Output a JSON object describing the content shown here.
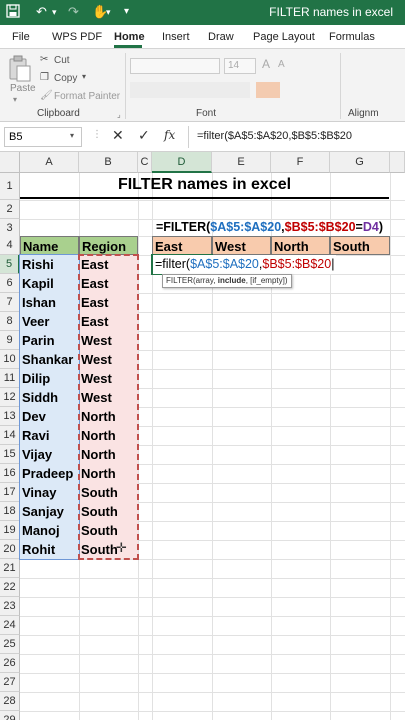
{
  "window": {
    "title": "FILTER names in excel"
  },
  "ribbon_tabs": [
    "File",
    "WPS PDF",
    "Home",
    "Insert",
    "Draw",
    "Page Layout",
    "Formulas"
  ],
  "active_tab": "Home",
  "clipboard": {
    "paste": "Paste",
    "cut": "Cut",
    "copy": "Copy",
    "format_painter": "Format Painter",
    "label": "Clipboard"
  },
  "font_group": {
    "size": "14",
    "label": "Font"
  },
  "alignment_label": "Alignm",
  "formula_bar": {
    "name_box": "B5",
    "formula": "=filter($A$5:$A$20,$B$5:$B$20"
  },
  "columns": [
    "A",
    "B",
    "C",
    "D",
    "E",
    "F",
    "G"
  ],
  "rows": [
    "1",
    "2",
    "3",
    "4",
    "5",
    "6",
    "7",
    "8",
    "9",
    "10",
    "11",
    "12",
    "13",
    "14",
    "15",
    "16",
    "17",
    "18",
    "19",
    "20",
    "21",
    "22",
    "23",
    "24",
    "25",
    "26",
    "27",
    "28",
    "29"
  ],
  "sheet": {
    "title": "FILTER names in excel",
    "header_name": "Name",
    "header_region": "Region",
    "data": [
      {
        "name": "Rishi",
        "region": "East"
      },
      {
        "name": "Kapil",
        "region": "East"
      },
      {
        "name": "Ishan",
        "region": "East"
      },
      {
        "name": "Veer",
        "region": "East"
      },
      {
        "name": "Parin",
        "region": "West"
      },
      {
        "name": "Shankar",
        "region": "West"
      },
      {
        "name": "Dilip",
        "region": "West"
      },
      {
        "name": "Siddh",
        "region": "West"
      },
      {
        "name": "Dev",
        "region": "North"
      },
      {
        "name": "Ravi",
        "region": "North"
      },
      {
        "name": "Vijay",
        "region": "North"
      },
      {
        "name": "Pradeep",
        "region": "North"
      },
      {
        "name": "Vinay",
        "region": "South"
      },
      {
        "name": "Sanjay",
        "region": "South"
      },
      {
        "name": "Manoj",
        "region": "South"
      },
      {
        "name": "Rohit",
        "region": "South"
      }
    ],
    "formula_note": {
      "p1": "=FILTER(",
      "p2": "$A$5:$A$20",
      "p3": ",",
      "p4": "$B$5:$B$20",
      "p5": "=",
      "p6": "D4",
      "p7": ")"
    },
    "region_headers": [
      "East",
      "West",
      "North",
      "South"
    ],
    "editing": {
      "p1": "=filter(",
      "p2": "$A$5:$A$20",
      "p3": ",",
      "p4": "$B$5:$B$20"
    },
    "tooltip": {
      "fn": "FILTER(array, ",
      "bold": "include",
      "rest": ", [if_empty])"
    }
  },
  "colors": {
    "accent": "#217346",
    "blue_ref": "#1f6fbf",
    "red_ref": "#c00000",
    "purple_ref": "#7030a0"
  }
}
